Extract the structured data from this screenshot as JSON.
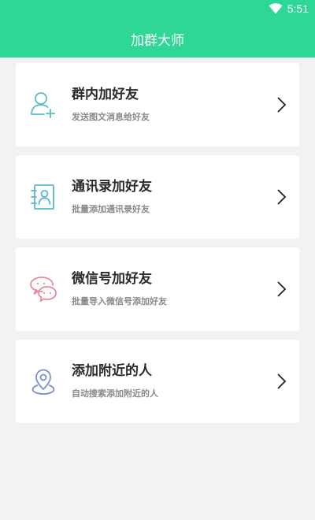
{
  "status_bar": {
    "time": "5:51",
    "wifi_icon": "wifi-icon"
  },
  "header": {
    "title": "加群大师"
  },
  "menu": {
    "items": [
      {
        "title": "群内加好友",
        "subtitle": "发送图文消息给好友",
        "icon": "add-user-icon",
        "icon_color": "#5bbcc8"
      },
      {
        "title": "通讯录加好友",
        "subtitle": "批量添加通讯录好友",
        "icon": "contacts-book-icon",
        "icon_color": "#56b7d0"
      },
      {
        "title": "微信号加好友",
        "subtitle": "批量导入微信号添加好友",
        "icon": "chat-bubbles-icon",
        "icon_color": "#e58c97"
      },
      {
        "title": "添加附近的人",
        "subtitle": "自动搜索添加附近的人",
        "icon": "location-pin-icon",
        "icon_color": "#7a8fcf"
      }
    ]
  },
  "colors": {
    "accent": "#2fd796",
    "background": "#f2f2f2"
  }
}
